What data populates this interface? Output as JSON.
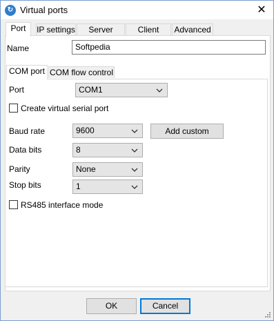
{
  "window": {
    "title": "Virtual ports",
    "close_symbol": "✕"
  },
  "main_tabs": [
    {
      "label": "Port",
      "active": true
    },
    {
      "label": "IP settings",
      "active": false
    },
    {
      "label": "Server mode",
      "active": false
    },
    {
      "label": "Client mode",
      "active": false
    },
    {
      "label": "Advanced",
      "active": false
    }
  ],
  "name_field": {
    "label": "Name",
    "value": "Softpedia"
  },
  "inner_tabs": [
    {
      "label": "COM port",
      "active": true
    },
    {
      "label": "COM flow control",
      "active": false
    }
  ],
  "com_port": {
    "port_label": "Port",
    "port_value": "COM1",
    "create_virtual_label": "Create virtual serial port",
    "create_virtual_checked": false,
    "baud_label": "Baud rate",
    "baud_value": "9600",
    "add_custom_label": "Add custom",
    "databits_label": "Data bits",
    "databits_value": "8",
    "parity_label": "Parity",
    "parity_value": "None",
    "stopbits_label": "Stop bits",
    "stopbits_value": "1",
    "rs485_label": "RS485 interface mode",
    "rs485_checked": false
  },
  "footer": {
    "ok_label": "OK",
    "cancel_label": "Cancel"
  },
  "colors": {
    "accent": "#0078d7",
    "panel_bg": "#ffffff",
    "window_bg": "#f0f0f0"
  }
}
